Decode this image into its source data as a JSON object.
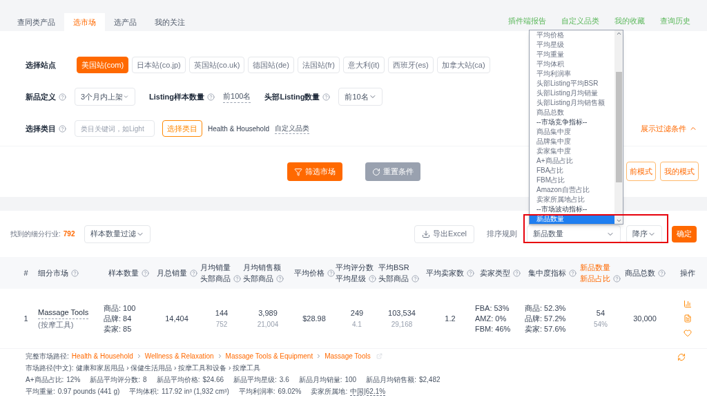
{
  "tabs": [
    {
      "label": "查同类产品",
      "selected": false
    },
    {
      "label": "选市场",
      "selected": true
    },
    {
      "label": "选产品",
      "selected": false
    },
    {
      "label": "我的关注",
      "selected": false
    }
  ],
  "top_links": [
    "插件端报告",
    "自定义品类",
    "我的收藏",
    "查询历史"
  ],
  "station": {
    "label": "选择站点",
    "options": [
      {
        "label": "美国站(com)",
        "selected": true
      },
      {
        "label": "日本站(co.jp)",
        "selected": false
      },
      {
        "label": "英国站(co.uk)",
        "selected": false
      },
      {
        "label": "德国站(de)",
        "selected": false
      },
      {
        "label": "法国站(fr)",
        "selected": false
      },
      {
        "label": "意大利(it)",
        "selected": false
      },
      {
        "label": "西班牙(es)",
        "selected": false
      },
      {
        "label": "加拿大站(ca)",
        "selected": false
      }
    ]
  },
  "new_def": {
    "label": "新品定义",
    "value": "3个月内上架"
  },
  "listing_sample": {
    "label": "Listing样本数量",
    "value": "前100名"
  },
  "head_listing": {
    "label": "头部Listing数量",
    "value": "前10名"
  },
  "category": {
    "label": "选择类目",
    "placeholder": "类目关键词，如Light",
    "button": "选择类目",
    "current": "Health & Household",
    "custom_link": "自定义品类"
  },
  "toggle_filters": "展示过滤条件",
  "actions": {
    "filter": "筛选市场",
    "reset": "重置条件",
    "mode_partial": "前模式",
    "my_mode": "我的模式"
  },
  "results": {
    "label": "找到的细分行业:",
    "count": "792",
    "filter_select": "样本数量过滤",
    "export": "导出Excel",
    "sort_label": "排序规则",
    "sort_value": "新品数量",
    "order": "降序",
    "confirm": "确定"
  },
  "sort_dropdown": {
    "options": [
      {
        "label": "平均价格",
        "kind": "option",
        "selected": false
      },
      {
        "label": "平均星级",
        "kind": "option",
        "selected": false
      },
      {
        "label": "平均重量",
        "kind": "option",
        "selected": false
      },
      {
        "label": "平均体积",
        "kind": "option",
        "selected": false
      },
      {
        "label": "平均利润率",
        "kind": "option",
        "selected": false
      },
      {
        "label": "头部Listing平均BSR",
        "kind": "option",
        "selected": false
      },
      {
        "label": "头部Listing月均销量",
        "kind": "option",
        "selected": false
      },
      {
        "label": "头部Listing月均销售额",
        "kind": "option",
        "selected": false
      },
      {
        "label": "商品总数",
        "kind": "option",
        "selected": false
      },
      {
        "label": "--市场竞争指标--",
        "kind": "group",
        "selected": false
      },
      {
        "label": "商品集中度",
        "kind": "option",
        "selected": false
      },
      {
        "label": "品牌集中度",
        "kind": "option",
        "selected": false
      },
      {
        "label": "卖家集中度",
        "kind": "option",
        "selected": false
      },
      {
        "label": "A+商品占比",
        "kind": "option",
        "selected": false
      },
      {
        "label": "FBA占比",
        "kind": "option",
        "selected": false
      },
      {
        "label": "FBM占比",
        "kind": "option",
        "selected": false
      },
      {
        "label": "Amazon自营占比",
        "kind": "option",
        "selected": false
      },
      {
        "label": "卖家所属地占比",
        "kind": "option",
        "selected": false
      },
      {
        "label": "--市场波动指标--",
        "kind": "group",
        "selected": false
      },
      {
        "label": "新品数量",
        "kind": "option",
        "selected": true
      }
    ]
  },
  "table": {
    "columns": [
      {
        "lines": [
          "#"
        ],
        "help": false,
        "highlight": false
      },
      {
        "lines": [
          "细分市场"
        ],
        "help": true,
        "highlight": false
      },
      {
        "lines": [
          "样本数量"
        ],
        "help": true,
        "highlight": false
      },
      {
        "lines": [
          "月总销量"
        ],
        "help": true,
        "highlight": false
      },
      {
        "lines": [
          "月均销量",
          "头部商品"
        ],
        "help": true,
        "highlight": false
      },
      {
        "lines": [
          "月均销售额",
          "头部商品"
        ],
        "help": true,
        "highlight": false
      },
      {
        "lines": [
          "平均价格"
        ],
        "help": true,
        "highlight": false
      },
      {
        "lines": [
          "平均评分数",
          "平均星级"
        ],
        "help": true,
        "highlight": false
      },
      {
        "lines": [
          "平均BSR",
          "头部商品"
        ],
        "help": true,
        "highlight": false
      },
      {
        "lines": [
          "平均卖家数"
        ],
        "help": true,
        "highlight": false
      },
      {
        "lines": [
          "卖家类型"
        ],
        "help": true,
        "highlight": false
      },
      {
        "lines": [
          "集中度指标"
        ],
        "help": true,
        "highlight": false
      },
      {
        "lines": [
          "新品数量",
          "新品占比"
        ],
        "help": true,
        "highlight": true
      },
      {
        "lines": [
          "商品总数"
        ],
        "help": true,
        "highlight": false
      },
      {
        "lines": [
          "操作"
        ],
        "help": false,
        "highlight": false
      }
    ],
    "rows": [
      {
        "cells": [
          {
            "kind": "text",
            "value": "1"
          },
          {
            "kind": "market",
            "name": "Massage Tools",
            "sub": "(按摩工具)"
          },
          {
            "kind": "lines",
            "lines": [
              "商品: 100",
              "品牌: 84",
              "卖家: 85"
            ]
          },
          {
            "kind": "text",
            "value": "14,404"
          },
          {
            "kind": "pair",
            "main": "144",
            "sub": "752"
          },
          {
            "kind": "pair",
            "main": "3,989",
            "sub": "21,004"
          },
          {
            "kind": "text",
            "value": "$28.98"
          },
          {
            "kind": "pair",
            "main": "249",
            "sub": "4.1"
          },
          {
            "kind": "pair",
            "main": "103,534",
            "sub": "29,168"
          },
          {
            "kind": "text",
            "value": "1.2"
          },
          {
            "kind": "lines",
            "lines": [
              "FBA: 53%",
              "AMZ: 0%",
              "FBM: 46%"
            ]
          },
          {
            "kind": "lines",
            "lines": [
              "商品: 52.3%",
              "品牌: 57.2%",
              "卖家: 57.6%"
            ]
          },
          {
            "kind": "pair",
            "main": "54",
            "sub": "54%"
          },
          {
            "kind": "text",
            "value": "30,000"
          },
          {
            "kind": "actions"
          }
        ]
      }
    ]
  },
  "details": {
    "path_label": "完整市场路径:",
    "path": [
      "Health & Household",
      "Wellness & Relaxation",
      "Massage Tools & Equipment",
      "Massage Tools"
    ],
    "cn_path_label": "市场路径(中文):",
    "cn_path": "健康和家居用品 › 保健生活用品 › 按摩工具和设备 › 按摩工具",
    "stats": [
      {
        "label": "A+商品占比:",
        "value": "12%"
      },
      {
        "label": "新品平均评分数:",
        "value": "8"
      },
      {
        "label": "新品平均价格:",
        "value": "$24.66"
      },
      {
        "label": "新品平均星级:",
        "value": "3.6"
      },
      {
        "label": "新品月均销量:",
        "value": "100"
      },
      {
        "label": "新品月均销售额:",
        "value": "$2,482"
      }
    ],
    "stats2": [
      {
        "label": "平均重量:",
        "value": "0.97 pounds (441 g)",
        "link": false
      },
      {
        "label": "平均体积:",
        "value": "117.92 in³ (1,932 cm³)",
        "link": false
      },
      {
        "label": "平均利润率:",
        "value": "69.02%",
        "link": false
      },
      {
        "label": "卖家所属地:",
        "value": "中国|62.1%",
        "link": true
      }
    ]
  }
}
